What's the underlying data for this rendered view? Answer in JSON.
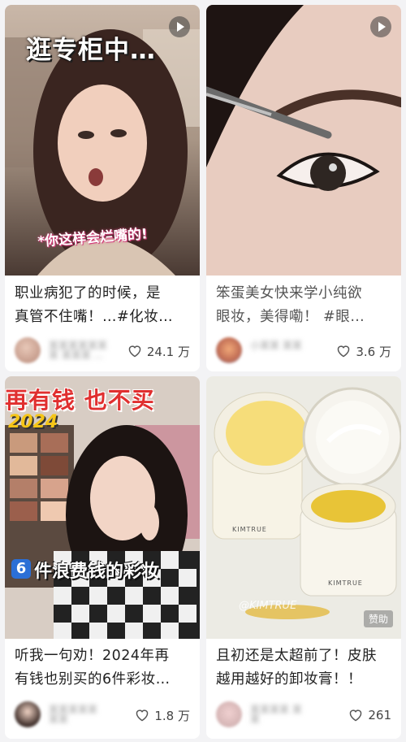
{
  "cards": [
    {
      "overlay_title": "逛专柜中…",
      "overlay_caption": "*你这样会烂嘴的!",
      "title": "职业病犯了的时候，是\n真管不住嘴！…#化妆…",
      "author": "某某某某某某某\n某某某 ...",
      "likes": "24.1 万"
    },
    {
      "title": "笨蛋美女快来学小纯欲\n眼妆，美得嘞！ #眼…",
      "author": "小某某\n某某",
      "likes": "3.6 万"
    },
    {
      "overlay_title_line1": "再有钱 也不买",
      "overlay_year": "2024",
      "overlay_num": "6",
      "overlay_sub": "件浪费钱的彩妆",
      "title": "听我一句劝！2024年再\n有钱也别买的6件彩妆…",
      "author": "某某某某某\n某某",
      "likes": "1.8 万"
    },
    {
      "brand_a": "KIMTRUE",
      "brand_b": "KIMTRUE",
      "watermark": "@KIMTRUE",
      "ad_label": "赞助",
      "title": "且初还是太超前了！皮肤\n越用越好的卸妆膏！！",
      "author": "某某某某\n某某",
      "likes": "261"
    }
  ]
}
